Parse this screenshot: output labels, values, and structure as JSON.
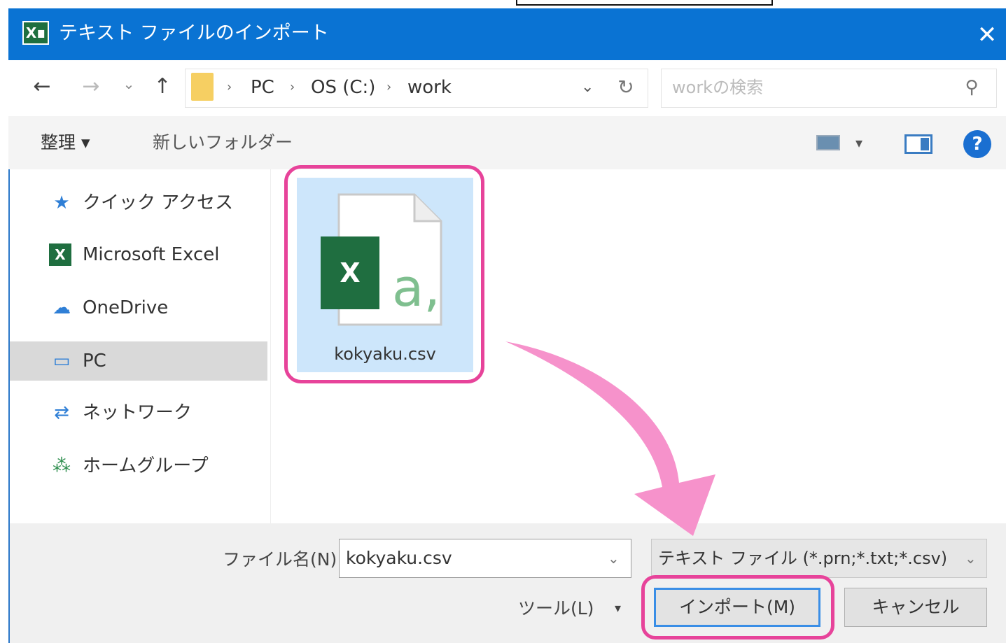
{
  "title_bar": {
    "app_badge": "X∎",
    "title": "テキスト ファイルのインポート",
    "close_glyph": "✕"
  },
  "address_bar": {
    "back_glyph": "←",
    "forward_glyph": "→",
    "history_glyph": "⌄",
    "up_glyph": "↑",
    "breadcrumb": [
      "PC",
      "OS (C:)",
      "work"
    ],
    "separator_glyph": "›",
    "dropdown_glyph": "⌄",
    "refresh_glyph": "↻",
    "search_placeholder": "workの検索",
    "search_glyph": "⚲"
  },
  "command_bar": {
    "organize_label": "整理 ▾",
    "new_folder_label": "新しいフォルダー",
    "view_dropdown_glyph": "▾",
    "help_glyph": "?"
  },
  "sidebar": {
    "items": [
      {
        "label": "クイック アクセス",
        "icon": "star-icon",
        "glyph": "★",
        "color": "#2f7fd6"
      },
      {
        "label": "Microsoft Excel",
        "icon": "excel-icon",
        "glyph": "X",
        "color": "#1f6e40"
      },
      {
        "label": "OneDrive",
        "icon": "cloud-icon",
        "glyph": "☁",
        "color": "#2f7fd6"
      },
      {
        "label": "PC",
        "icon": "computer-icon",
        "glyph": "▭",
        "color": "#2f7fd6",
        "selected": true
      },
      {
        "label": "ネットワーク",
        "icon": "network-icon",
        "glyph": "⇄",
        "color": "#2f7fd6"
      },
      {
        "label": "ホームグループ",
        "icon": "homegroup-icon",
        "glyph": "⁂",
        "color": "#2f8f4f"
      }
    ]
  },
  "files": [
    {
      "name": "kokyaku.csv",
      "badge": "X",
      "glyph": "a,",
      "selected": true
    }
  ],
  "footer": {
    "file_name_label": "ファイル名(N):",
    "file_name_value": "kokyaku.csv",
    "file_type": "テキスト ファイル (*.prn;*.txt;*.csv)",
    "dropdown_glyph": "⌄",
    "tools_label": "ツール(L)",
    "tools_dropdown_glyph": "▾",
    "import_label": "インポート(M)",
    "cancel_label": "キャンセル"
  },
  "annotations": {
    "highlight_color": "#e7439a",
    "arrow_color": "#f58cc8"
  },
  "colors": {
    "title_bar": "#0a73d3",
    "excel_green": "#1f6e40",
    "selection": "#cde6fb"
  }
}
